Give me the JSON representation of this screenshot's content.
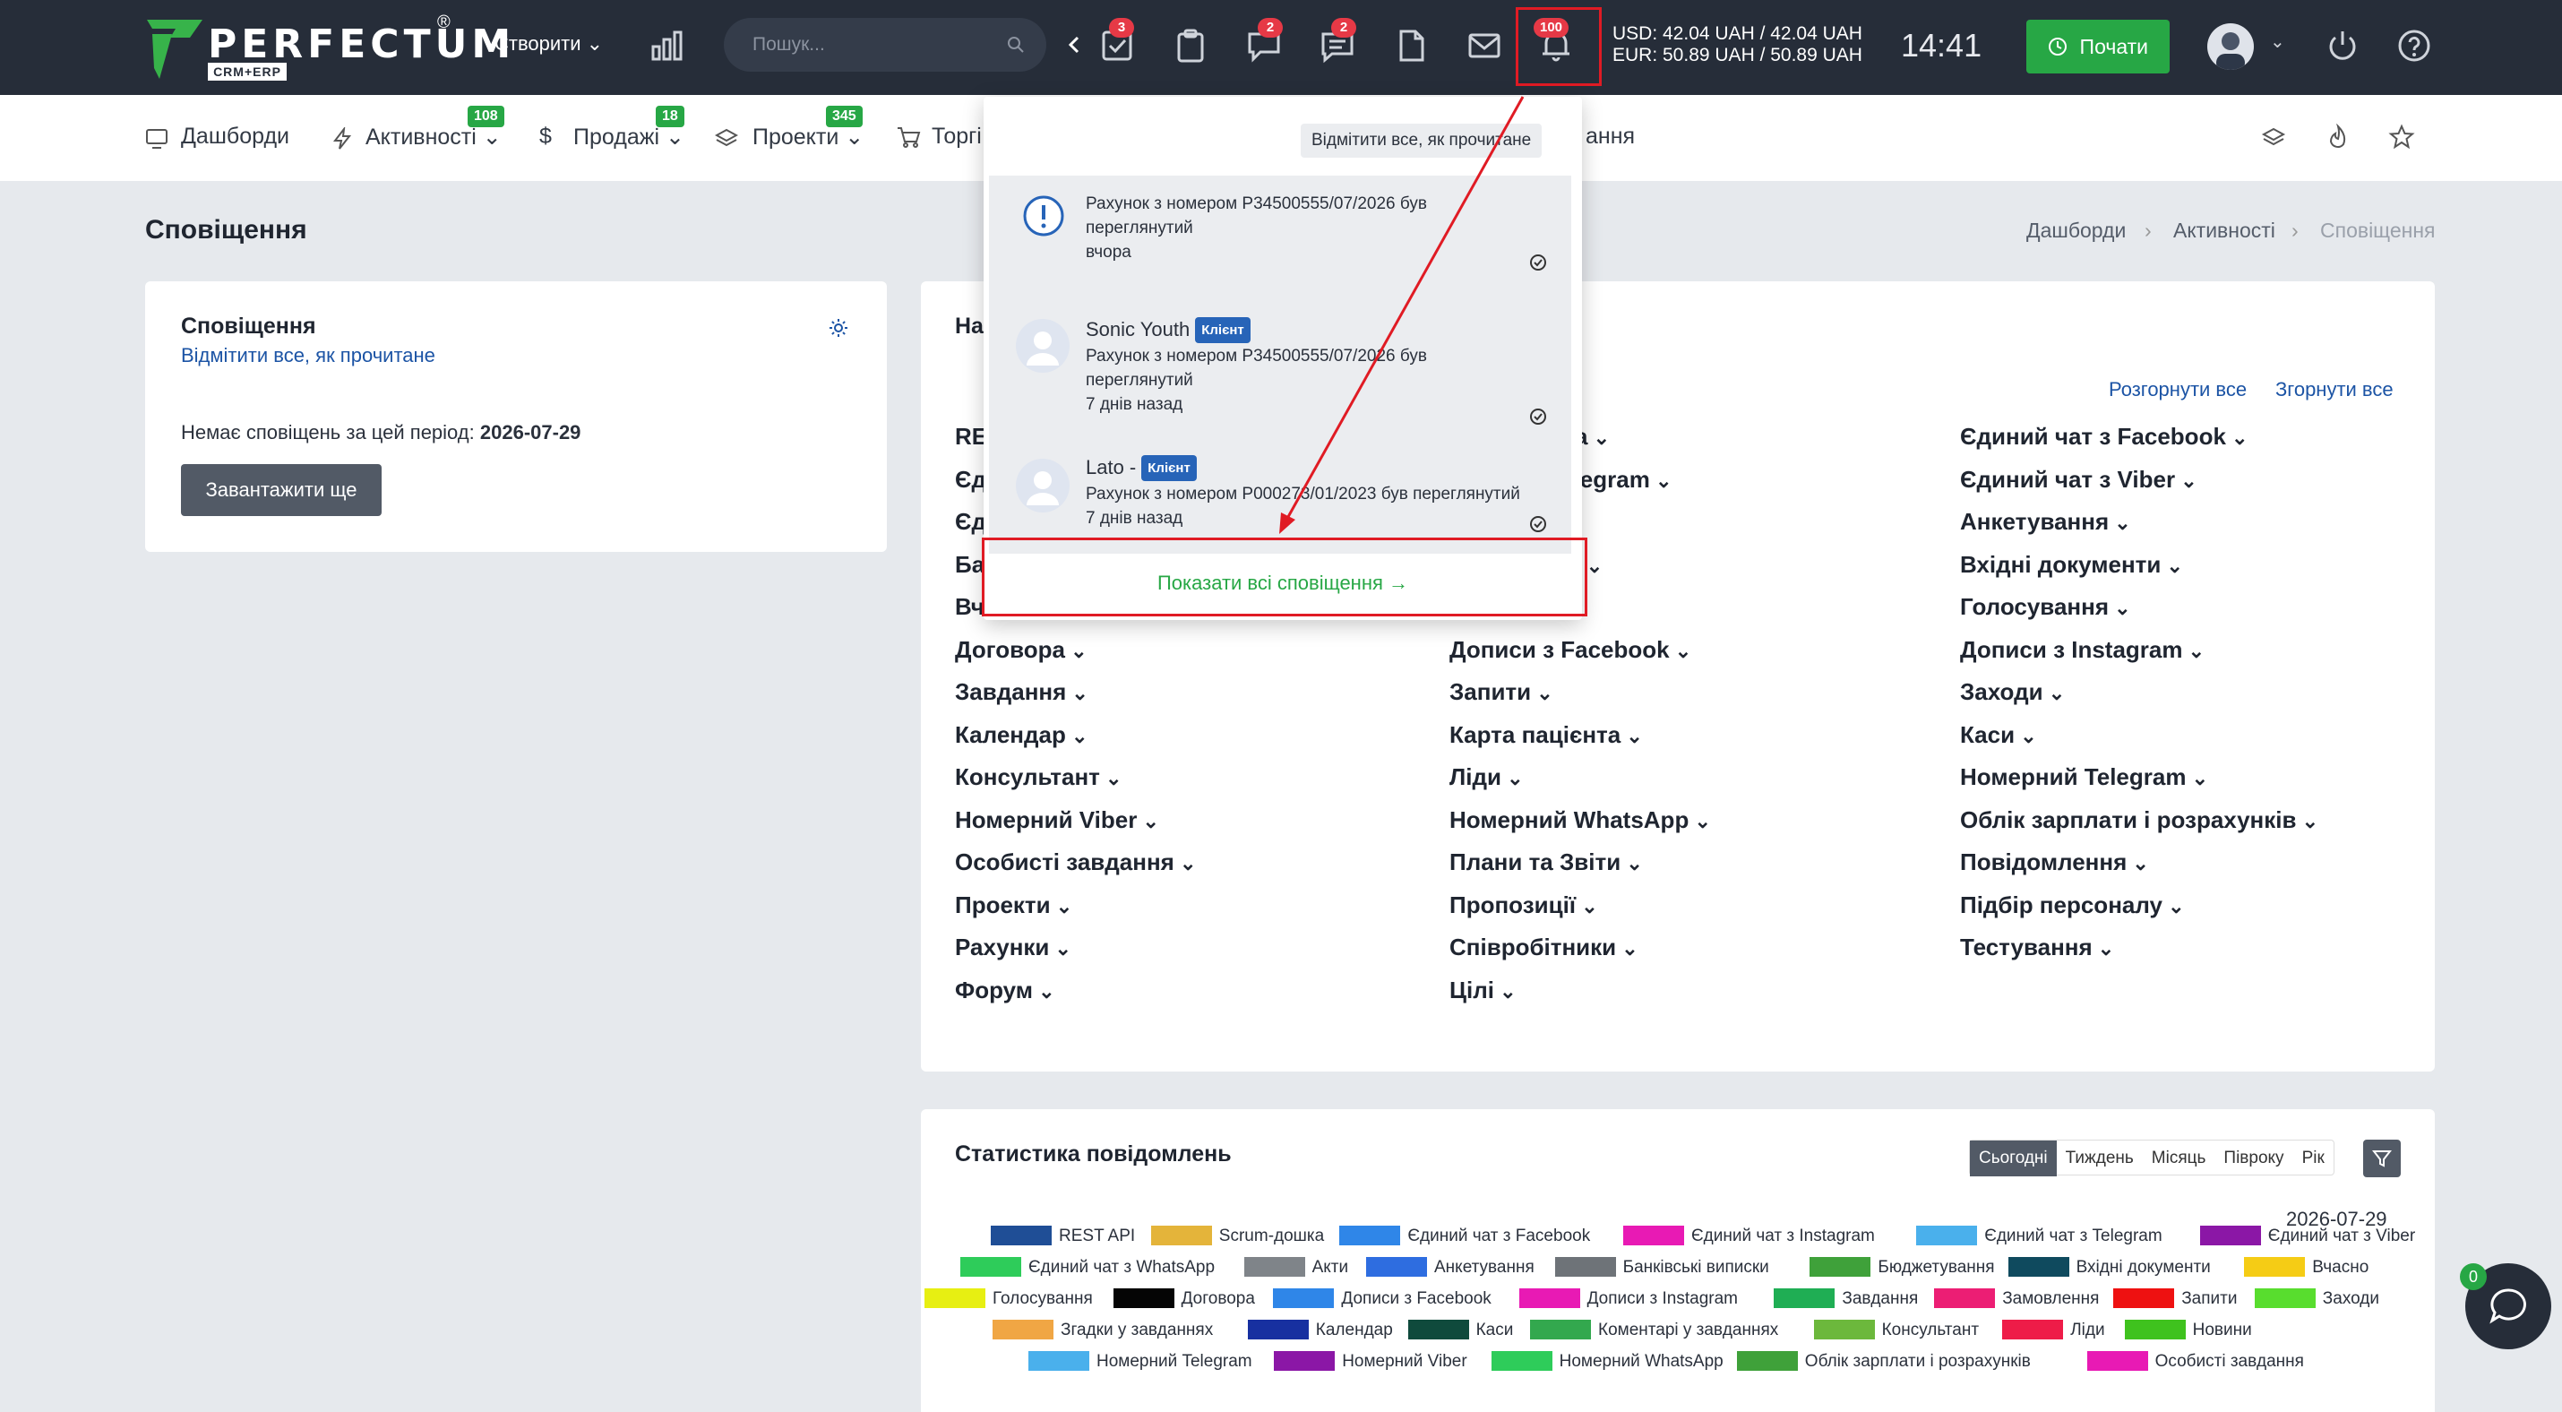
{
  "brand": {
    "name": "PERFECTUM",
    "sub": "CRM+ERP",
    "reg": "®"
  },
  "topbar": {
    "create_label": "Створити",
    "search_placeholder": "Пошук...",
    "badge_tasks": "3",
    "badge_chat": "2",
    "badge_messages": "2",
    "badge_notifications": "100",
    "usd": "USD: 42.04 UAH / 42.04 UAH",
    "eur": "EUR: 50.89 UAH / 50.89 UAH",
    "time": "14:41",
    "start_label": "Почати"
  },
  "nav": {
    "items": [
      {
        "label": "Дашборди"
      },
      {
        "label": "Активності",
        "badge": "108"
      },
      {
        "label": "Продажі",
        "badge": "18"
      },
      {
        "label": "Проекти",
        "badge": "345"
      },
      {
        "label": "Торгі"
      },
      {
        "label": "ання"
      }
    ]
  },
  "page": {
    "title": "Сповіщення",
    "breadcrumb": [
      "Дашборди",
      "Активності",
      "Сповіщення"
    ]
  },
  "left_card": {
    "title": "Сповіщення",
    "mark_all": "Відмітити все, як прочитане",
    "empty_prefix": "Немає сповіщень за цей період: ",
    "empty_date": "2026-07-29",
    "load_more": "Завантажити ще"
  },
  "settings_card": {
    "title_partial": "На",
    "expand_all": "Розгорнути все",
    "collapse_all": "Згорнути все",
    "col1": [
      "RE",
      "Єд",
      "Єд",
      "Ба",
      "Вч",
      "Договора",
      "Завдання",
      "Календар",
      "Консультант",
      "Номерний Viber",
      "Особисті завдання",
      "Проекти",
      "Рахунки",
      "Форум"
    ],
    "col2": [
      "а",
      "з Telegram",
      "",
      "ння",
      "",
      "Дописи з Facebook",
      "Запити",
      "Карта пацієнта",
      "Ліди",
      "Номерний WhatsApp",
      "Плани та Звіти",
      "Пропозиції",
      "Співробітники",
      "Цілі"
    ],
    "col3": [
      "Єдиний чат з Facebook",
      "Єдиний чат з Viber",
      "Анкетування",
      "Вхідні документи",
      "Голосування",
      "Дописи з Instagram",
      "Заходи",
      "Каси",
      "Номерний Telegram",
      "Облік зарплати і розрахунків",
      "Повідомлення",
      "Підбір персоналу",
      "Тестування"
    ]
  },
  "dropdown": {
    "mark_all": "Відмітити все, як прочитане",
    "items": [
      {
        "name": "",
        "badge": "",
        "line1": "Рахунок з номером P34500555/07/2026 був",
        "line2": "переглянутий",
        "time": "вчора"
      },
      {
        "name": "Sonic Youth",
        "badge": "Клієнт",
        "line1": "Рахунок з номером P34500555/07/2026 був",
        "line2": "переглянутий",
        "time": "7 днів назад"
      },
      {
        "name": "Lato -",
        "badge": "Клієнт",
        "line1": "Рахунок з номером P000273/01/2023 був переглянутий",
        "line2": "",
        "time": "7 днів назад"
      }
    ],
    "show_all": "Показати всі сповіщення →"
  },
  "stats": {
    "title": "Статистика повідомлень",
    "tabs": [
      "Сьогодні",
      "Тиждень",
      "Місяць",
      "Півроку",
      "Рік"
    ],
    "date": "2026-07-29",
    "legend": [
      {
        "label": "REST API",
        "color": "#1f4e96"
      },
      {
        "label": "Scrum-дошка",
        "color": "#e4b43a"
      },
      {
        "label": "Єдиний чат з Facebook",
        "color": "#2f86e8"
      },
      {
        "label": "Єдиний чат з Instagram",
        "color": "#e81ab4"
      },
      {
        "label": "Єдиний чат з Telegram",
        "color": "#4ab0ec"
      },
      {
        "label": "Єдиний чат з Viber",
        "color": "#8b17a6"
      },
      {
        "label": "Єдиний чат з WhatsApp",
        "color": "#2ecc5a"
      },
      {
        "label": "Акти",
        "color": "#7f8489"
      },
      {
        "label": "Анкетування",
        "color": "#2e6de0"
      },
      {
        "label": "Банківські виписки",
        "color": "#6e7378"
      },
      {
        "label": "Бюджетування",
        "color": "#3fa13a"
      },
      {
        "label": "Вхідні документи",
        "color": "#0f4a5e"
      },
      {
        "label": "Вчасно",
        "color": "#f5cc15"
      },
      {
        "label": "Голосування",
        "color": "#e7ef12"
      },
      {
        "label": "Договора",
        "color": "#050505"
      },
      {
        "label": "Дописи з Facebook",
        "color": "#2f86e8"
      },
      {
        "label": "Дописи з Instagram",
        "color": "#e81ab4"
      },
      {
        "label": "Завдання",
        "color": "#1fae54"
      },
      {
        "label": "Замовлення",
        "color": "#ec1e74"
      },
      {
        "label": "Запити",
        "color": "#ee1111"
      },
      {
        "label": "Заходи",
        "color": "#58dd2e"
      },
      {
        "label": "Згадки у завданнях",
        "color": "#f0a644"
      },
      {
        "label": "Календар",
        "color": "#1730a0"
      },
      {
        "label": "Каси",
        "color": "#0f4a3c"
      },
      {
        "label": "Коментарі у завданнях",
        "color": "#33a84e"
      },
      {
        "label": "Консультант",
        "color": "#6cb83c"
      },
      {
        "label": "Ліди",
        "color": "#ee1c48"
      },
      {
        "label": "Новини",
        "color": "#3fc21e"
      },
      {
        "label": "Номерний Telegram",
        "color": "#4ab0ec"
      },
      {
        "label": "Номерний Viber",
        "color": "#8b17a6"
      },
      {
        "label": "Номерний WhatsApp",
        "color": "#2ecc5a"
      },
      {
        "label": "Облік зарплати і розрахунків",
        "color": "#3fa13a"
      },
      {
        "label": "Особисті завдання",
        "color": "#e81ab4"
      }
    ]
  },
  "chat": {
    "count": "0"
  }
}
